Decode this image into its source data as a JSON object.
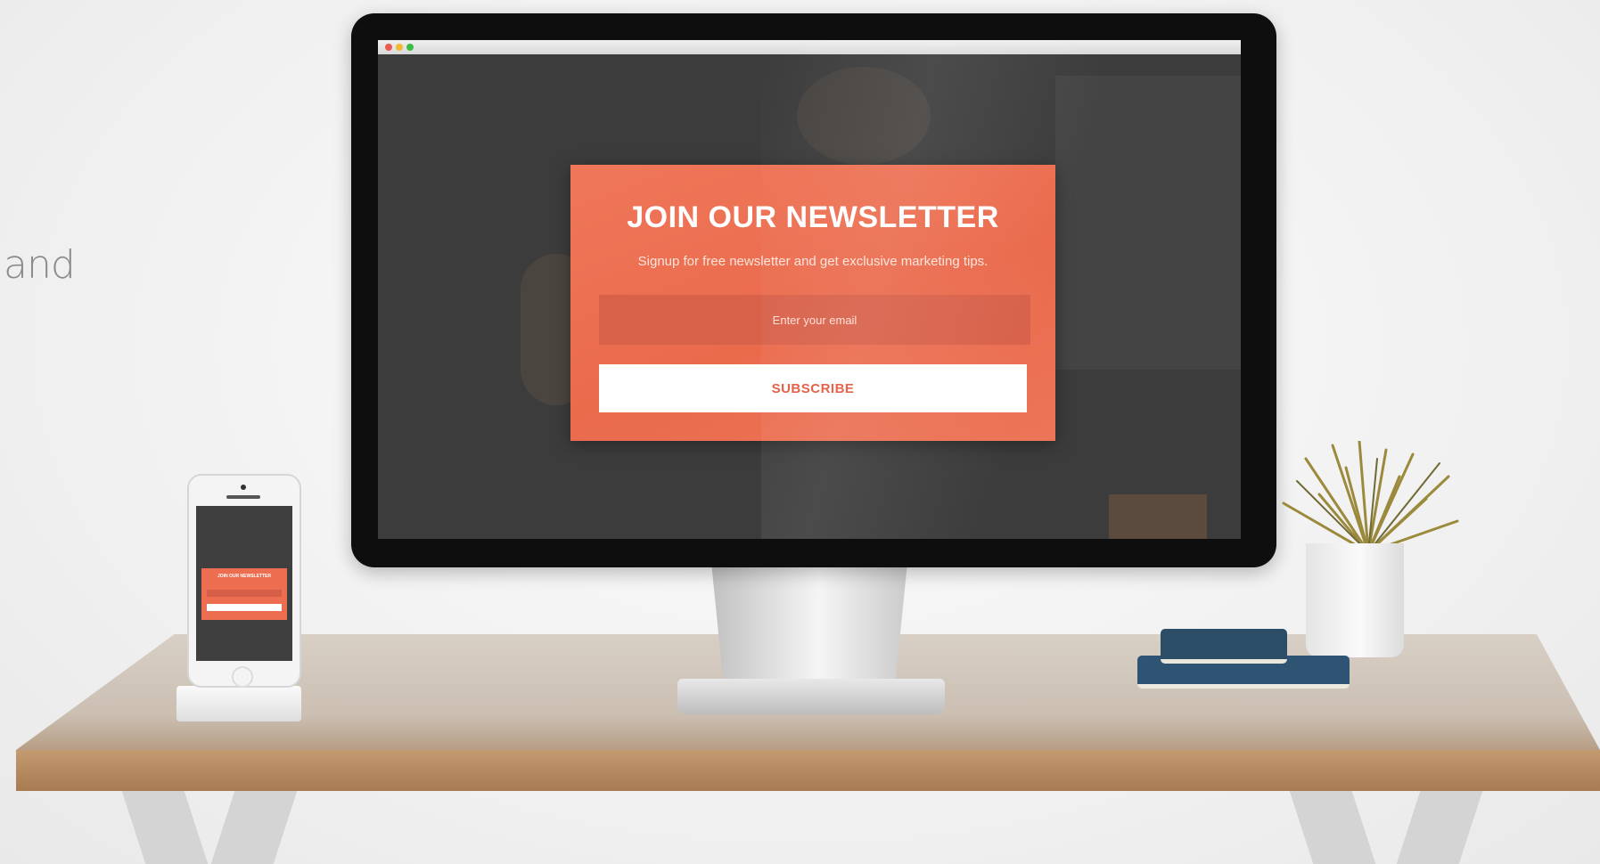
{
  "side_text": "and",
  "browser": {
    "dots": [
      "red",
      "yellow",
      "green"
    ]
  },
  "newsletter": {
    "title": "JOIN OUR NEWSLETTER",
    "subtitle": "Signup for free newsletter and get exclusive marketing tips.",
    "email_placeholder": "Enter your email",
    "button_label": "SUBSCRIBE"
  },
  "phone_newsletter": {
    "title": "JOIN OUR NEWSLETTER"
  },
  "colors": {
    "accent": "#ec6d50",
    "button_text": "#e2593d",
    "background": "#f2f2f2"
  }
}
